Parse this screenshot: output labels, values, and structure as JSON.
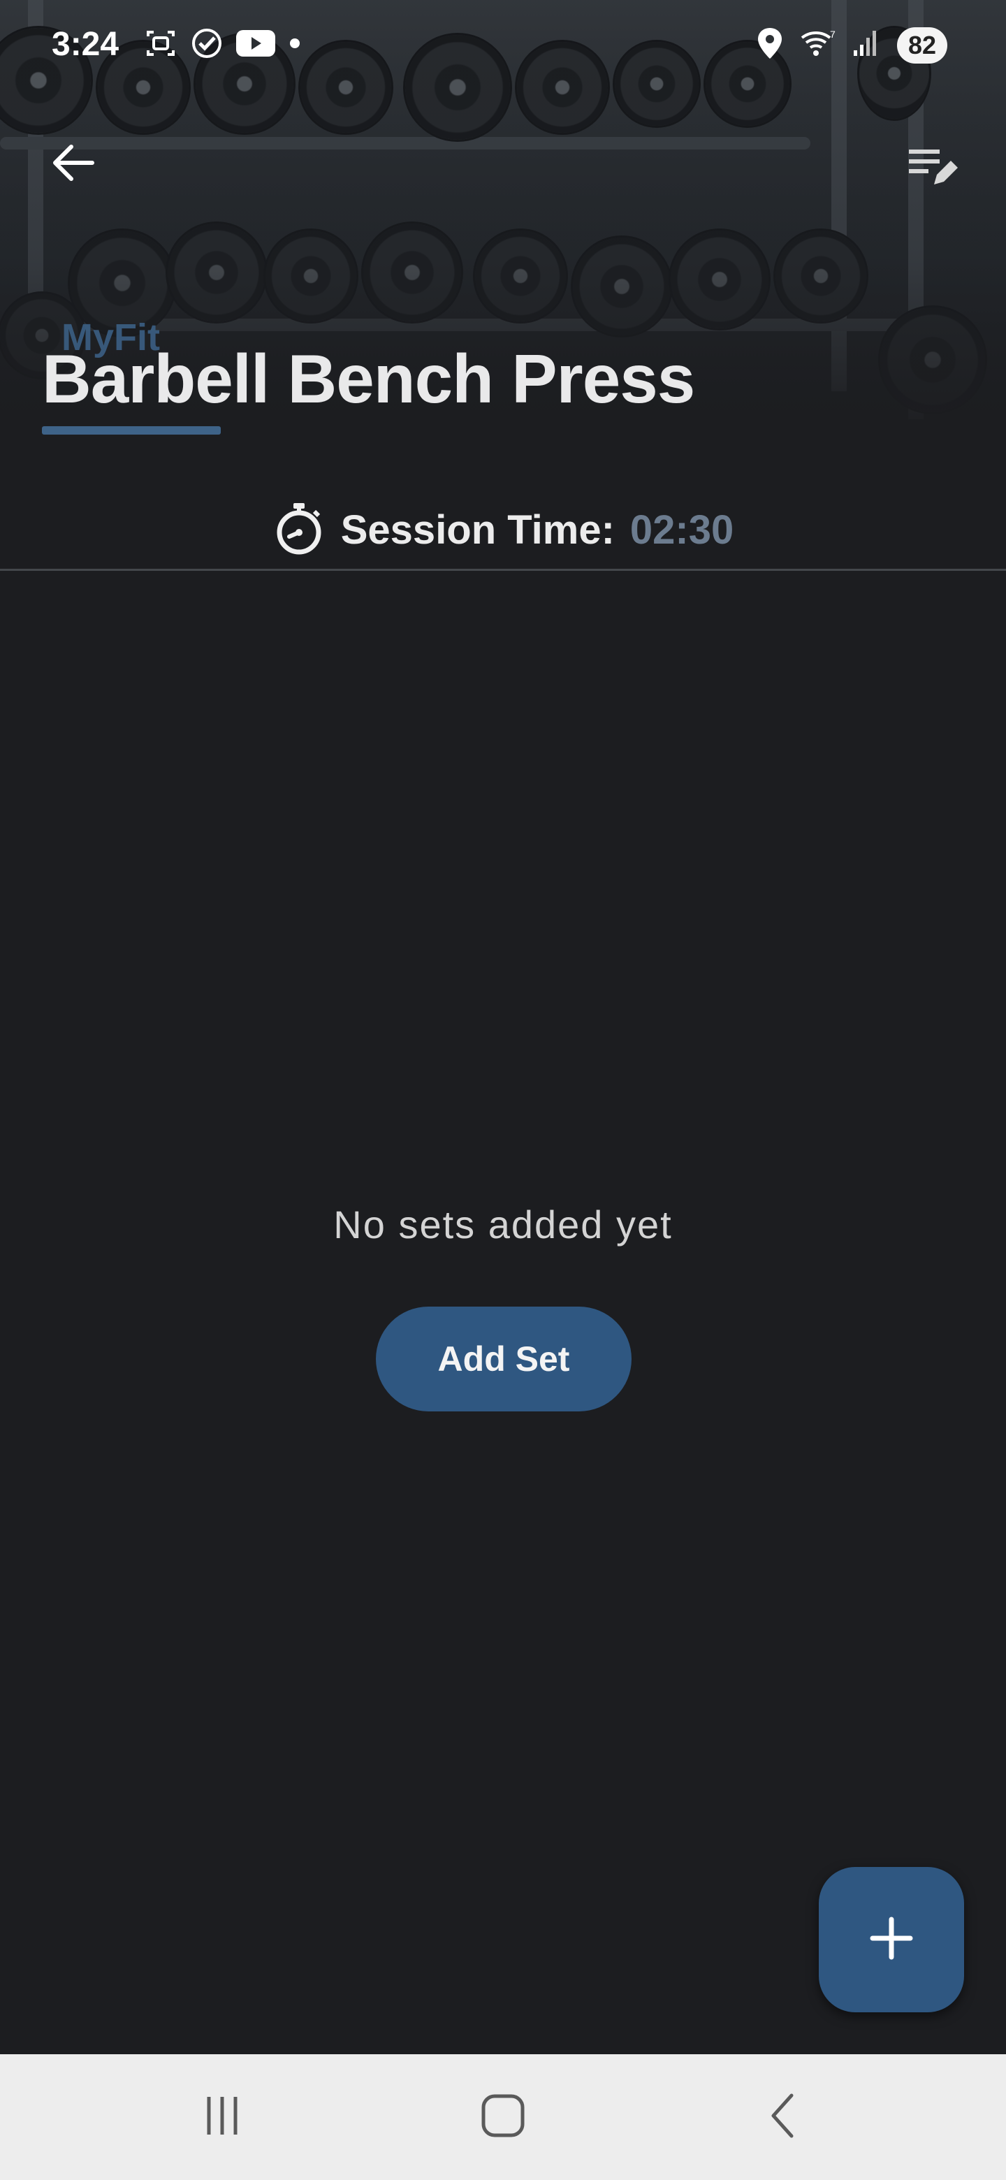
{
  "status_bar": {
    "time": "3:24",
    "battery": "82",
    "left_icons": [
      "screenshot-icon",
      "check-circle-icon",
      "youtube-icon",
      "dot-icon"
    ],
    "right_icons": [
      "location-icon",
      "wifi-icon",
      "signal-icon"
    ]
  },
  "header": {
    "brand": "MyFit",
    "title": "Barbell Bench Press",
    "back_icon": "arrow-left-icon",
    "edit_icon": "list-edit-icon"
  },
  "session": {
    "icon": "stopwatch-icon",
    "label": "Session Time:",
    "value": "02:30"
  },
  "empty_state": {
    "message": "No sets added yet",
    "button_label": "Add Set"
  },
  "fab": {
    "icon": "plus-icon"
  },
  "nav_bar": {
    "buttons": [
      "recent-apps-icon",
      "home-icon",
      "back-icon"
    ]
  },
  "colors": {
    "background": "#1c1d20",
    "accent": "#2f5781",
    "session_value": "#6c7c8f",
    "nav_bar": "#ededed"
  }
}
